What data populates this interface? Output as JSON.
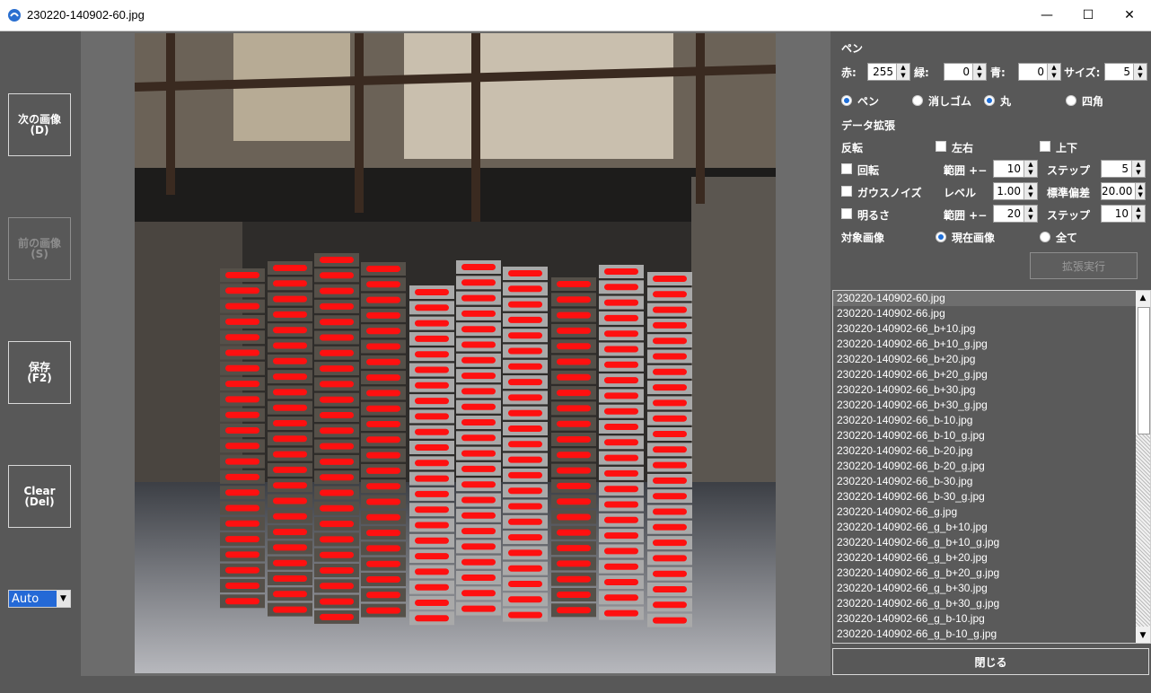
{
  "window": {
    "title": "230220-140902-60.jpg",
    "minimize": "—",
    "maximize": "☐",
    "close": "✕"
  },
  "left": {
    "next": {
      "line1": "次の画像",
      "line2": "(D)"
    },
    "prev": {
      "line1": "前の画像",
      "line2": "(S)"
    },
    "save": {
      "line1": "保存",
      "line2": "(F2)"
    },
    "clear": {
      "line1": "Clear",
      "line2": "(Del)"
    },
    "auto": "Auto"
  },
  "pen": {
    "title": "ペン",
    "red_label": "赤:",
    "red": "255",
    "green_label": "緑:",
    "green": "0",
    "blue_label": "青:",
    "blue": "0",
    "size_label": "サイズ:",
    "size": "5",
    "mode_pen": "ペン",
    "mode_eraser": "消しゴム",
    "shape_round": "丸",
    "shape_square": "四角"
  },
  "augment": {
    "title": "データ拡張",
    "flip": "反転",
    "flip_lr": "左右",
    "flip_ud": "上下",
    "rotate": "回転",
    "range_label": "範囲 +−",
    "rotate_range": "10",
    "step_label": "ステップ",
    "rotate_step": "5",
    "gauss": "ガウスノイズ",
    "level_label": "レベル",
    "gauss_level": "1.00",
    "std_label": "標準偏差",
    "gauss_std": "20.00",
    "bright": "明るさ",
    "bright_range": "20",
    "bright_step": "10",
    "target": "対象画像",
    "target_current": "現在画像",
    "target_all": "全て",
    "exec": "拡張実行"
  },
  "files": [
    "230220-140902-60.jpg",
    "230220-140902-66.jpg",
    "230220-140902-66_b+10.jpg",
    "230220-140902-66_b+10_g.jpg",
    "230220-140902-66_b+20.jpg",
    "230220-140902-66_b+20_g.jpg",
    "230220-140902-66_b+30.jpg",
    "230220-140902-66_b+30_g.jpg",
    "230220-140902-66_b-10.jpg",
    "230220-140902-66_b-10_g.jpg",
    "230220-140902-66_b-20.jpg",
    "230220-140902-66_b-20_g.jpg",
    "230220-140902-66_b-30.jpg",
    "230220-140902-66_b-30_g.jpg",
    "230220-140902-66_g.jpg",
    "230220-140902-66_g_b+10.jpg",
    "230220-140902-66_g_b+10_g.jpg",
    "230220-140902-66_g_b+20.jpg",
    "230220-140902-66_g_b+20_g.jpg",
    "230220-140902-66_g_b+30.jpg",
    "230220-140902-66_g_b+30_g.jpg",
    "230220-140902-66_g_b-10.jpg",
    "230220-140902-66_g_b-10_g.jpg"
  ],
  "close_button": "閉じる",
  "colors": {
    "annotation": "#ff1010",
    "selected_radio": "#1f6fd8",
    "auto_select": "#2469d6"
  }
}
